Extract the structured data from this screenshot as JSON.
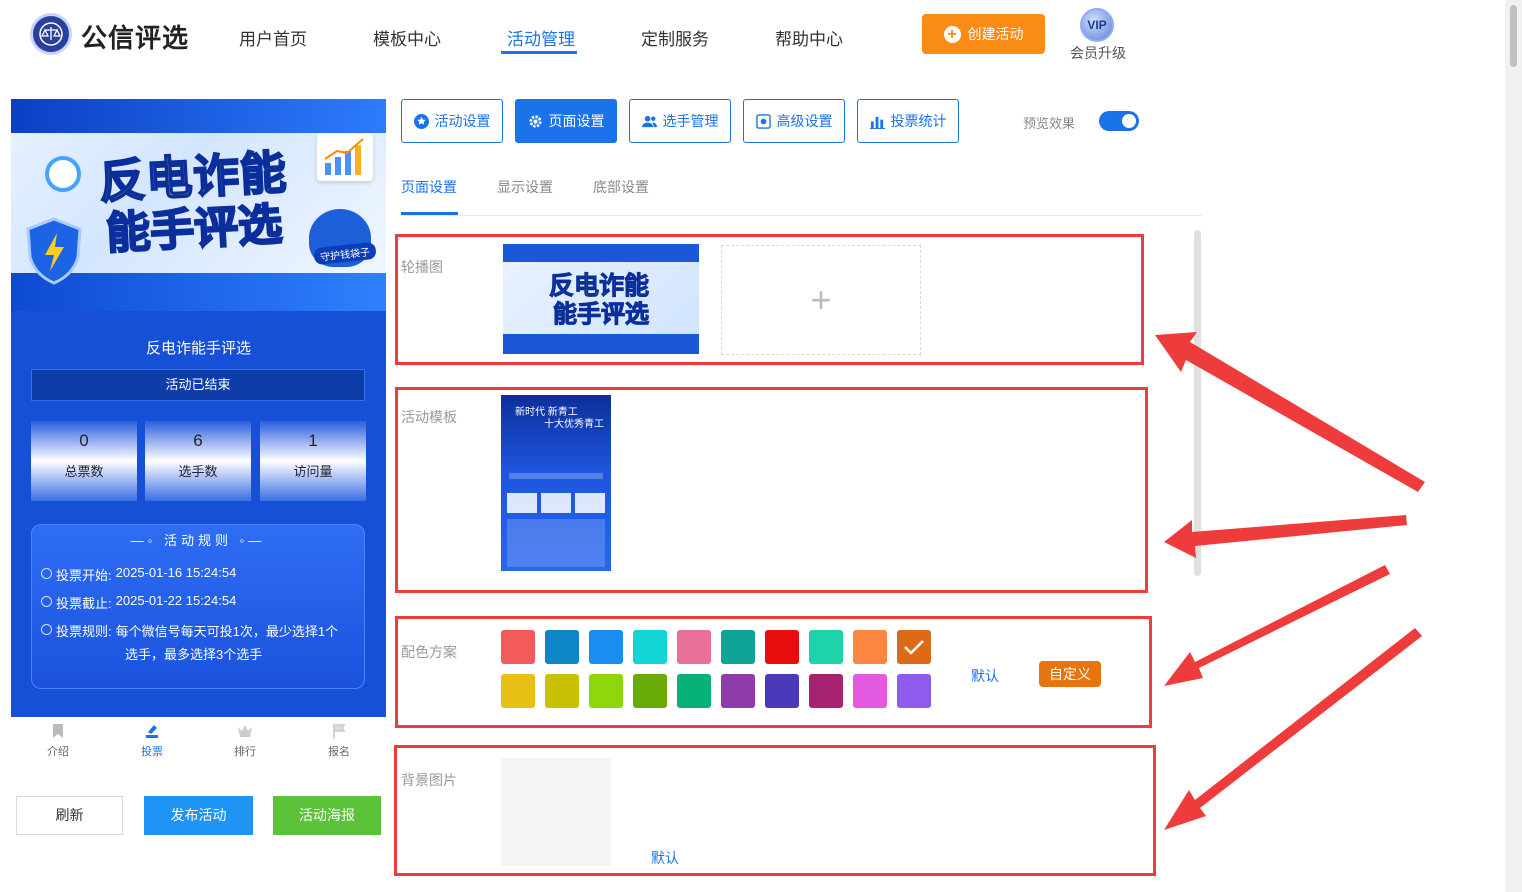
{
  "brand": {
    "name": "公信评选",
    "logo_icon": "scales-icon"
  },
  "nav": {
    "items": [
      {
        "label": "用户首页",
        "active": false
      },
      {
        "label": "模板中心",
        "active": false
      },
      {
        "label": "活动管理",
        "active": true
      },
      {
        "label": "定制服务",
        "active": false
      },
      {
        "label": "帮助中心",
        "active": false
      }
    ],
    "create_button": "创建活动",
    "vip_badge": "VIP",
    "vip_label": "会员升级"
  },
  "preview": {
    "banner_line1": "反电诈能",
    "banner_line2": "能手评选",
    "banner_tag": "守护钱袋子",
    "activity_title": "反电诈能手评选",
    "status": "活动已结束",
    "stats": [
      {
        "value": "0",
        "label": "总票数"
      },
      {
        "value": "6",
        "label": "选手数"
      },
      {
        "value": "1",
        "label": "访问量"
      }
    ],
    "rules_title": "活动规则",
    "vote_start_label": "投票开始:",
    "vote_start_value": "2025-01-16 15:24:54",
    "vote_end_label": "投票截止:",
    "vote_end_value": "2025-01-22 15:24:54",
    "vote_rule_label": "投票规则:",
    "vote_rule_line1": "每个微信号每天可投1次，最少选择1个",
    "vote_rule_line2": "选手，最多选择3个选手",
    "tabs": [
      {
        "label": "介绍",
        "icon": "bookmark-icon",
        "active": false
      },
      {
        "label": "投票",
        "icon": "vote-icon",
        "active": true
      },
      {
        "label": "排行",
        "icon": "crown-icon",
        "active": false
      },
      {
        "label": "报名",
        "icon": "flag-icon",
        "active": false
      }
    ]
  },
  "actions": {
    "refresh": "刷新",
    "publish": "发布活动",
    "poster": "活动海报"
  },
  "toolbar": {
    "buttons": [
      {
        "label": "活动设置",
        "icon": "star-icon",
        "active": false
      },
      {
        "label": "页面设置",
        "icon": "gear-icon",
        "active": true
      },
      {
        "label": "选手管理",
        "icon": "users-icon",
        "active": false
      },
      {
        "label": "高级设置",
        "icon": "settings-sliders-icon",
        "active": false
      },
      {
        "label": "投票统计",
        "icon": "bar-chart-icon",
        "active": false
      }
    ],
    "preview_label": "预览效果",
    "preview_on": true
  },
  "subtabs": [
    {
      "label": "页面设置",
      "active": true
    },
    {
      "label": "显示设置",
      "active": false
    },
    {
      "label": "底部设置",
      "active": false
    }
  ],
  "sections": {
    "carousel_label": "轮播图",
    "carousel_upload": "+",
    "template_label": "活动模板",
    "template_preview_line1": "新时代 新青工",
    "template_preview_line2": "十大优秀青工",
    "color_label": "配色方案",
    "color_default": "默认",
    "color_custom": "自定义",
    "bg_label": "背景图片",
    "bg_default": "默认"
  },
  "colors": {
    "row1": [
      "#f25b5b",
      "#0c86c4",
      "#1a8ef0",
      "#12d6d6",
      "#e8709a",
      "#0ea396",
      "#e80c0c",
      "#1ed3a8",
      "#fd8642",
      "#dd6a16"
    ],
    "row2": [
      "#e8c015",
      "#c9c106",
      "#8fd60d",
      "#67ab05",
      "#08b07a",
      "#8f3cab",
      "#4a39b8",
      "#a8236f",
      "#e35ae0",
      "#8f5bef"
    ],
    "selected": "#dd6a16",
    "accent": "#1a73e8"
  }
}
